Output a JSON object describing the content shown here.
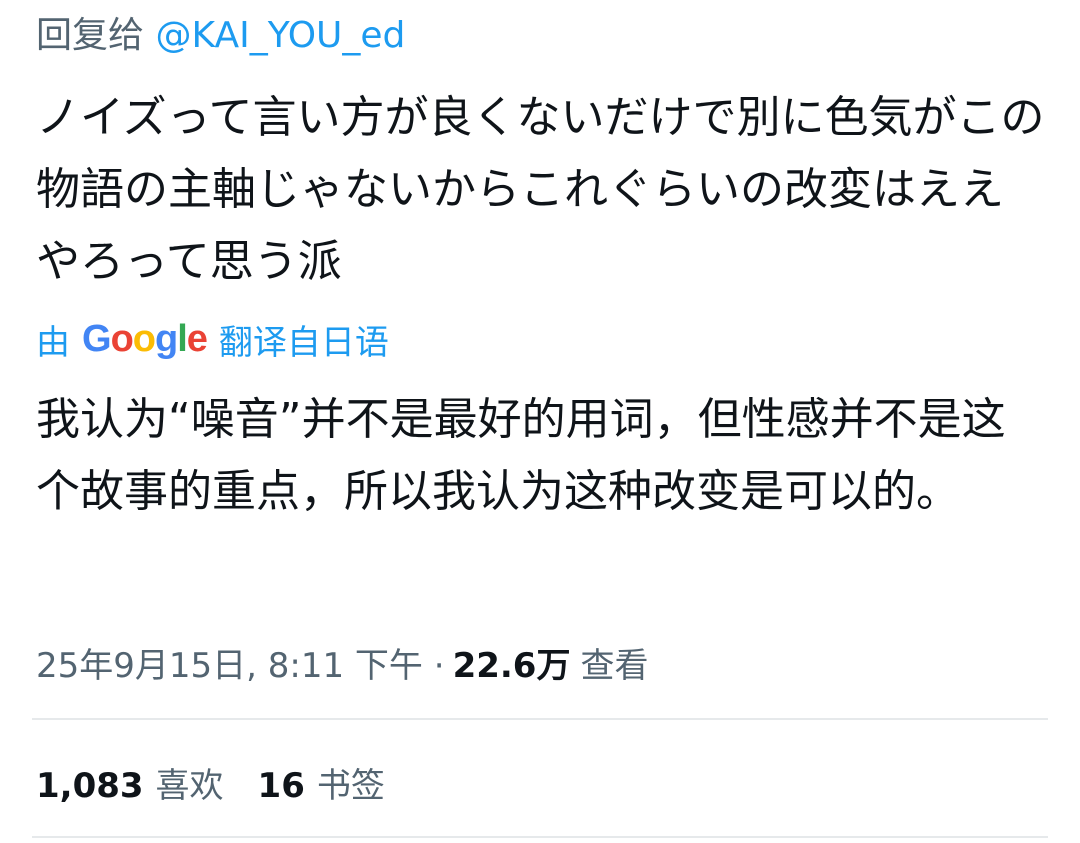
{
  "reply": {
    "prefix": "回复给",
    "handle": "@KAI_YOU_ed"
  },
  "tweet": {
    "text": "ノイズって言い方が良くないだけで別に色気がこの物語の主軸じゃないからこれぐらいの改変はええやろって思う派"
  },
  "translation": {
    "prefix": "由",
    "provider_logo": {
      "letters": [
        "G",
        "o",
        "o",
        "g",
        "l",
        "e"
      ],
      "colors": [
        "#4285f4",
        "#ea4335",
        "#fbbc05",
        "#4285f4",
        "#34a853",
        "#ea4335"
      ]
    },
    "suffix": "翻译自日语",
    "text": "我认为“噪音”并不是最好的用词，但性感并不是这个故事的重点，所以我认为这种改变是可以的。"
  },
  "meta": {
    "datetime": "25年9月15日, 8:11 下午 ·",
    "views_count": "22.6万",
    "views_label": "查看"
  },
  "stats": {
    "likes_count": "1,083",
    "likes_label": "喜欢",
    "bookmarks_count": "16",
    "bookmarks_label": "书签"
  },
  "colors": {
    "link": "#1d9bf0",
    "secondary_text": "#536471",
    "primary_text": "#0f1419",
    "divider": "#e6e9eb"
  }
}
